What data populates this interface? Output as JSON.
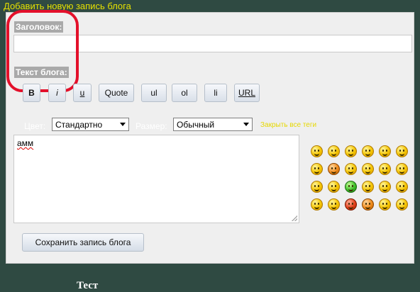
{
  "page": {
    "title": "Добавить новую запись блога"
  },
  "form": {
    "title_label": "Заголовок:",
    "title_value": "",
    "text_label": "Текст блога:",
    "text_value": "амм"
  },
  "toolbar": {
    "buttons": [
      "B",
      "i",
      "u",
      "Quote",
      "ul",
      "ol",
      "li",
      "URL"
    ]
  },
  "options": {
    "color_label": "Цвет:",
    "color_value": "Стандартно",
    "size_label": "Размер:",
    "size_value": "Обычный",
    "close_tags": "Закрыть все теги"
  },
  "smileys": {
    "rows": [
      [
        "smile-icon",
        "wink-icon",
        "cool-icon",
        "grin-icon",
        "laugh-icon",
        "surprised-icon"
      ],
      [
        "tongue-icon",
        "blush-icon",
        "shocked-icon",
        "big-eyes-icon",
        "confused-icon",
        "sad-icon"
      ],
      [
        "angry-icon",
        "eyes-roll-icon",
        "sick-icon",
        "rolleyes-icon",
        "sleepy-icon",
        "cry-icon"
      ],
      [
        "mad-icon",
        "dizzy-icon",
        "devil-icon",
        "blushing-icon",
        "ponder-icon",
        "kiss-icon"
      ]
    ]
  },
  "actions": {
    "save_label": "Сохранить запись блога"
  },
  "footer": {
    "text": "Тест"
  },
  "colors": {
    "background": "#2f4a42",
    "panel": "#efefef",
    "accent_yellow": "#e6e000",
    "annotation_red": "#e3102a"
  }
}
